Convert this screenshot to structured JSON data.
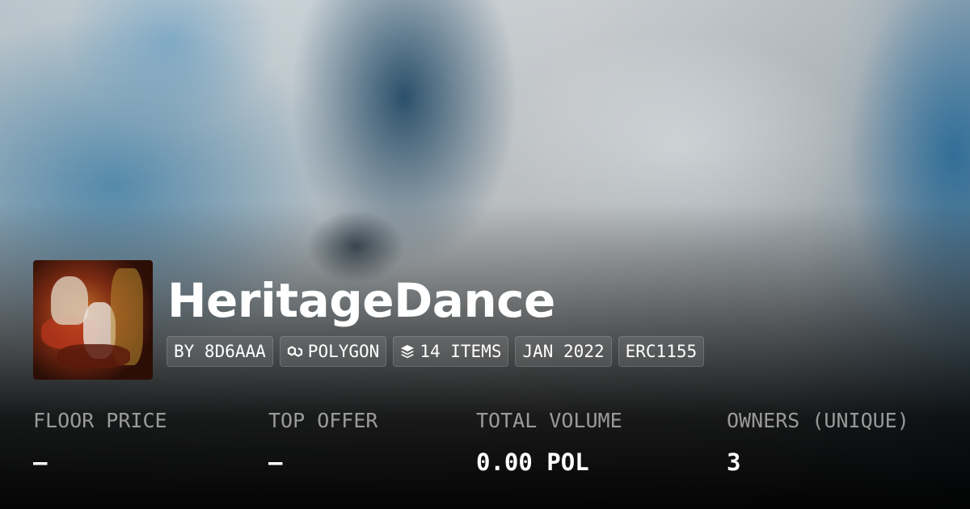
{
  "collection": {
    "name": "HeritageDance"
  },
  "chips": {
    "creator": "BY 8D6AAA",
    "chain": "POLYGON",
    "items": "14 ITEMS",
    "date": "JAN 2022",
    "standard": "ERC1155"
  },
  "icons": {
    "chain": "polygon-icon",
    "items": "layers-icon"
  },
  "stats": [
    {
      "label": "FLOOR PRICE",
      "value": "–"
    },
    {
      "label": "TOP OFFER",
      "value": "–"
    },
    {
      "label": "TOTAL VOLUME",
      "value": "0.00 POL"
    },
    {
      "label": "OWNERS (UNIQUE)",
      "value": "3"
    }
  ],
  "colors": {
    "text": "#ffffff",
    "muted_label": "rgba(255,255,255,0.56)",
    "background_tint": "#3a82af"
  }
}
